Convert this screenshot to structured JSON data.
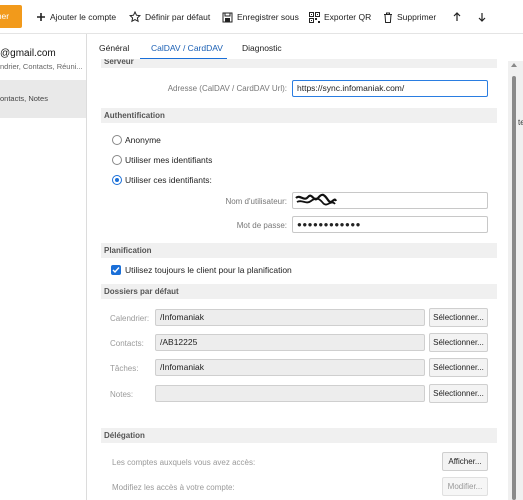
{
  "toolbar": {
    "orange_label": "rner",
    "items": [
      {
        "label": "Ajouter le compte",
        "icon": "plus-icon"
      },
      {
        "label": "Définir par défaut",
        "icon": "star-icon"
      },
      {
        "label": "Enregistrer sous",
        "icon": "save-icon"
      },
      {
        "label": "Exporter QR",
        "icon": "qr-code-icon"
      },
      {
        "label": "Supprimer",
        "icon": "trash-icon"
      }
    ],
    "up_icon": "arrow-up-icon",
    "down_icon": "arrow-down-icon"
  },
  "accounts": [
    {
      "email": "@gmail.com",
      "sub": "ndrier, Contacts, Réuni..."
    },
    {
      "sub": "ontacts, Notes"
    }
  ],
  "tabs": [
    "Général",
    "CalDAV / CardDAV",
    "Diagnostic"
  ],
  "active_tab": "CalDAV / CardDAV",
  "sections": {
    "serveur": {
      "title": "Serveur",
      "address_label": "Adresse (CalDAV / CardDAV Url):",
      "address_value": "https://sync.infomaniak.com/"
    },
    "auth": {
      "title": "Authentification",
      "options": [
        "Anonyme",
        "Utiliser mes identifiants",
        "Utiliser ces identifiants:"
      ],
      "selected_option": "Utiliser ces identifiants:",
      "username_label": "Nom d'utilisateur:",
      "password_label": "Mot de passe:",
      "password_value": "●●●●●●●●●●●●"
    },
    "planning": {
      "title": "Planification",
      "checkbox_label": "Utilisez toujours le client pour la planification",
      "checked": true
    },
    "folders": {
      "title": "Dossiers par défaut",
      "rows": [
        {
          "label": "Calendrier:",
          "value": "/Infomaniak",
          "button": "Sélectionner..."
        },
        {
          "label": "Contacts:",
          "value": "/AB12225",
          "button": "Sélectionner..."
        },
        {
          "label": "Tâches:",
          "value": "/Infomaniak",
          "button": "Sélectionner..."
        },
        {
          "label": "Notes:",
          "value": "",
          "button": "Sélectionner..."
        }
      ]
    },
    "delegation": {
      "title": "Délégation",
      "row1_label": "Les comptes auxquels vous avez accès:",
      "row1_button": "Afficher...",
      "row2_label": "Modifiez les accès à votre compte:",
      "row2_button": "Modifier..."
    }
  },
  "edge_text": "te",
  "colors": {
    "accent": "#1a6fd8",
    "orange": "#f29a1b",
    "section_bg": "#f0f0f0"
  }
}
